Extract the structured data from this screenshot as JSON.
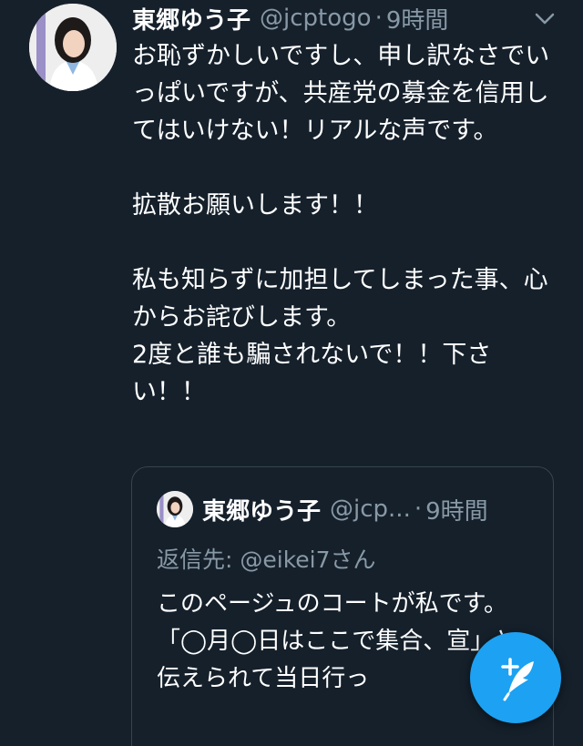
{
  "author": {
    "name": "東郷ゆう子",
    "handle": "@jcptogo",
    "separator": "·",
    "time": "9時間"
  },
  "tweet": {
    "text": "お恥ずかしいですし、申し訳なさでいっぱいですが、共産党の募金を信用してはいけない！リアルな声です。\n\n拡散お願いします！！\n\n私も知らずに加担してしまった事、心からお詫びします。\n2度と誰も騙されないで！！下さい！！"
  },
  "quoted_tweet": {
    "name": "東郷ゆう子",
    "handle": "@jcp...",
    "separator": "·",
    "time": "9時間",
    "reply_prefix": "返信先: ",
    "reply_mention": "@eikei7",
    "reply_suffix": "さん",
    "text": "このページュのコートが私です。\n「◯月◯日はここで集合、宣」と伝えられて当日行っ"
  },
  "icons": {
    "menu": "chevron-down-icon",
    "compose": "compose-tweet-icon"
  },
  "colors": {
    "background": "#15202b",
    "secondary_text": "#8899a6",
    "border": "#38444d",
    "accent": "#1da1f2"
  }
}
